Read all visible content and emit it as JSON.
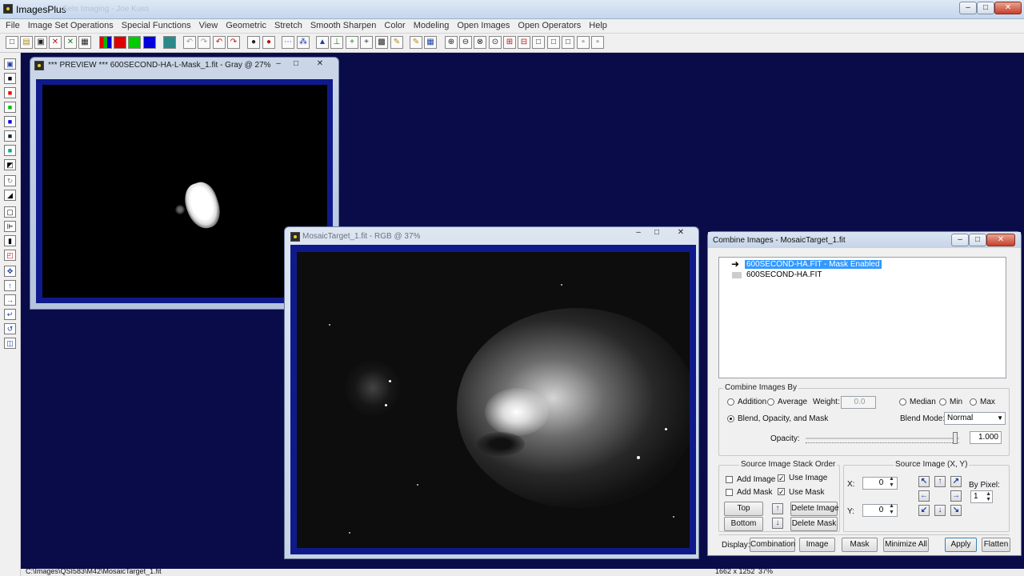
{
  "app": {
    "title": "ImagesPlus",
    "title_suffix": "Sets Imaging - Joe Kuss"
  },
  "menu": [
    "File",
    "Image Set Operations",
    "Special Functions",
    "View",
    "Geometric",
    "Stretch",
    "Smooth Sharpen",
    "Color",
    "Modeling",
    "Open Images",
    "Open Operators",
    "Help"
  ],
  "window_controls": {
    "minimize": "–",
    "maximize": "□",
    "close": "✕"
  },
  "toolbar_icons": [
    "new-icon",
    "open-icon",
    "save-icon",
    "close-image-icon",
    "close-all-icon",
    "print-icon",
    "rgb-icon",
    "red-icon",
    "green-icon",
    "blue-icon",
    "channel-icon",
    "undo-icon",
    "redo-icon",
    "undo-red-icon",
    "redo-red-icon",
    "mask-icon",
    "mask-red-icon",
    "dots-icon",
    "stars-icon",
    "histogram-icon",
    "levels-icon",
    "crosshair-icon",
    "grid-icon",
    "palette-icon",
    "pencil-icon",
    "table-icon",
    "zoom-in-icon",
    "zoom-out-icon",
    "zoom-fit-icon",
    "zoom-1-icon",
    "zoom-plus-icon",
    "zoom-minus-icon",
    "frame-icon",
    "frame2-icon",
    "frame3-icon",
    "frame4-icon",
    "frame5-icon"
  ],
  "preview_window": {
    "title": "*** PREVIEW *** 600SECOND-HA-L-Mask_1.fit - Gray @ 27%"
  },
  "mosaic_window": {
    "title": "MosaicTarget_1.fit - RGB @ 37%"
  },
  "combine": {
    "title": "Combine Images - MosaicTarget_1.fit",
    "list": [
      {
        "label": "600SECOND-HA.FIT - Mask Enabled",
        "selected": true
      },
      {
        "label": "600SECOND-HA.FIT",
        "selected": false
      }
    ],
    "combine_by": {
      "legend": "Combine Images By",
      "addition": "Addition",
      "average": "Average",
      "weight_label": "Weight:",
      "weight_value": "0.0",
      "median": "Median",
      "min": "Min",
      "max": "Max",
      "blend": "Blend, Opacity, and Mask",
      "blend_mode_label": "Blend Mode:",
      "blend_mode_value": "Normal",
      "opacity_label": "Opacity:",
      "opacity_value": "1.000"
    },
    "stack": {
      "legend": "Source Image Stack Order",
      "add_image": "Add Image",
      "use_image": "Use Image",
      "add_mask": "Add Mask",
      "use_mask": "Use Mask",
      "top": "Top",
      "bottom": "Bottom",
      "delete_image": "Delete Image",
      "delete_mask": "Delete Mask"
    },
    "source_xy": {
      "legend": "Source Image (X, Y)",
      "x_label": "X:",
      "x_value": "0",
      "y_label": "Y:",
      "y_value": "0",
      "by_pixel_label": "By Pixel:",
      "by_pixel_value": "1"
    },
    "display_label": "Display:",
    "buttons": {
      "combination": "Combination",
      "image": "Image",
      "mask": "Mask",
      "minimize_all": "Minimize All",
      "apply": "Apply",
      "flatten": "Flatten"
    }
  },
  "status": {
    "path": "C:\\Images\\QSI583\\M42\\MosaicTarget_1.fit",
    "size": "1662 x 1252",
    "zoom": "37%"
  }
}
